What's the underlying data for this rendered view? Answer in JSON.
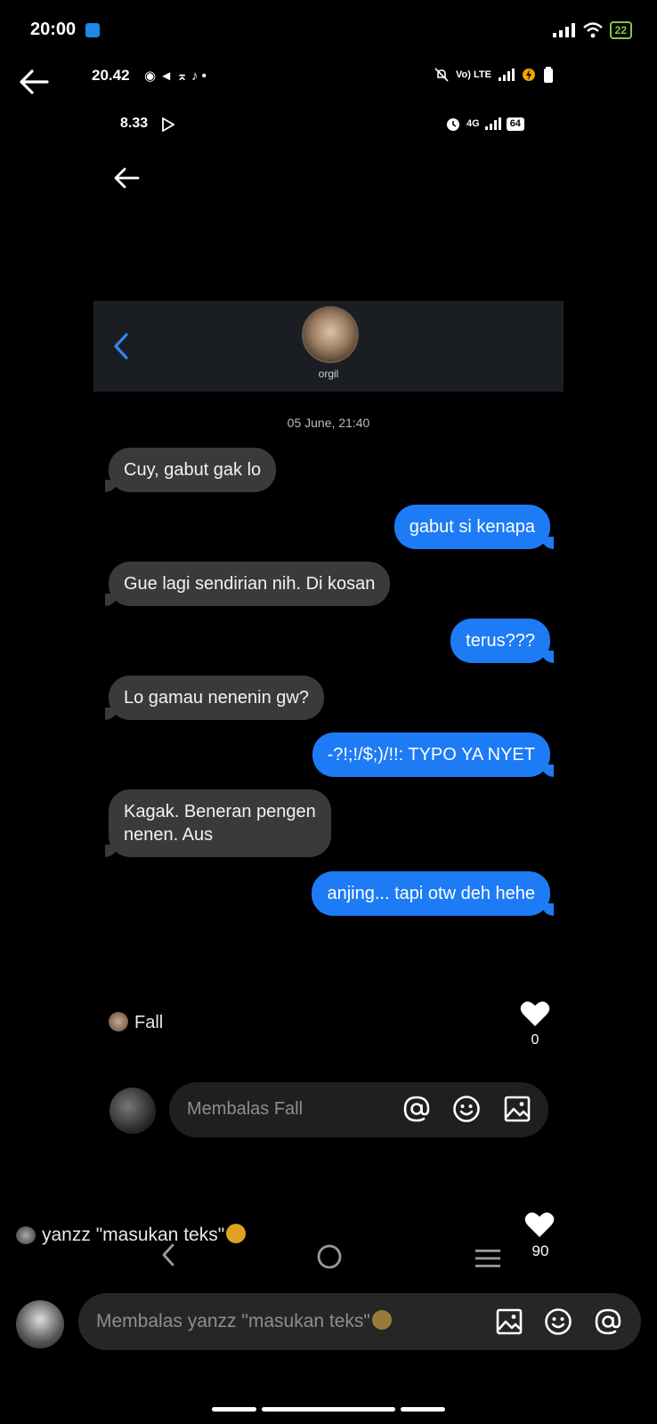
{
  "status_bar": {
    "time": "20:00",
    "battery": "22"
  },
  "inner_status_1": {
    "time": "20.42",
    "icons_text": "◉ ◄ ⌅ ♪ •",
    "network_text": "Vo) LTE"
  },
  "inner_status_2": {
    "time": "8.33",
    "network_text": "4G",
    "battery": "64"
  },
  "chat": {
    "contact_name": "orgil",
    "date": "05 June, 21:40",
    "messages": [
      {
        "side": "in",
        "text": "Cuy, gabut gak lo"
      },
      {
        "side": "out",
        "text": "gabut si kenapa"
      },
      {
        "side": "in",
        "text": "Gue lagi sendirian nih. Di kosan"
      },
      {
        "side": "out",
        "text": "terus???"
      },
      {
        "side": "in",
        "text": "Lo gamau nenenin gw?"
      },
      {
        "side": "out",
        "text": "-?!;!/$;)/!!: TYPO YA NYET"
      },
      {
        "side": "in",
        "text": "Kagak. Beneran pengen\nnenen. Aus"
      },
      {
        "side": "out",
        "text": "anjing... tapi otw deh hehe"
      }
    ]
  },
  "comment": {
    "author": "Fall",
    "likes": "0",
    "reply_placeholder": "Membalas Fall"
  },
  "bottom": {
    "author_text": "yanzz \"masukan teks\"",
    "likes": "90",
    "reply_placeholder": "Membalas yanzz \"masukan teks\""
  },
  "colors": {
    "outgoing_bubble": "#1d7bf5",
    "incoming_bubble": "#3a3a3c",
    "background": "#000000"
  }
}
